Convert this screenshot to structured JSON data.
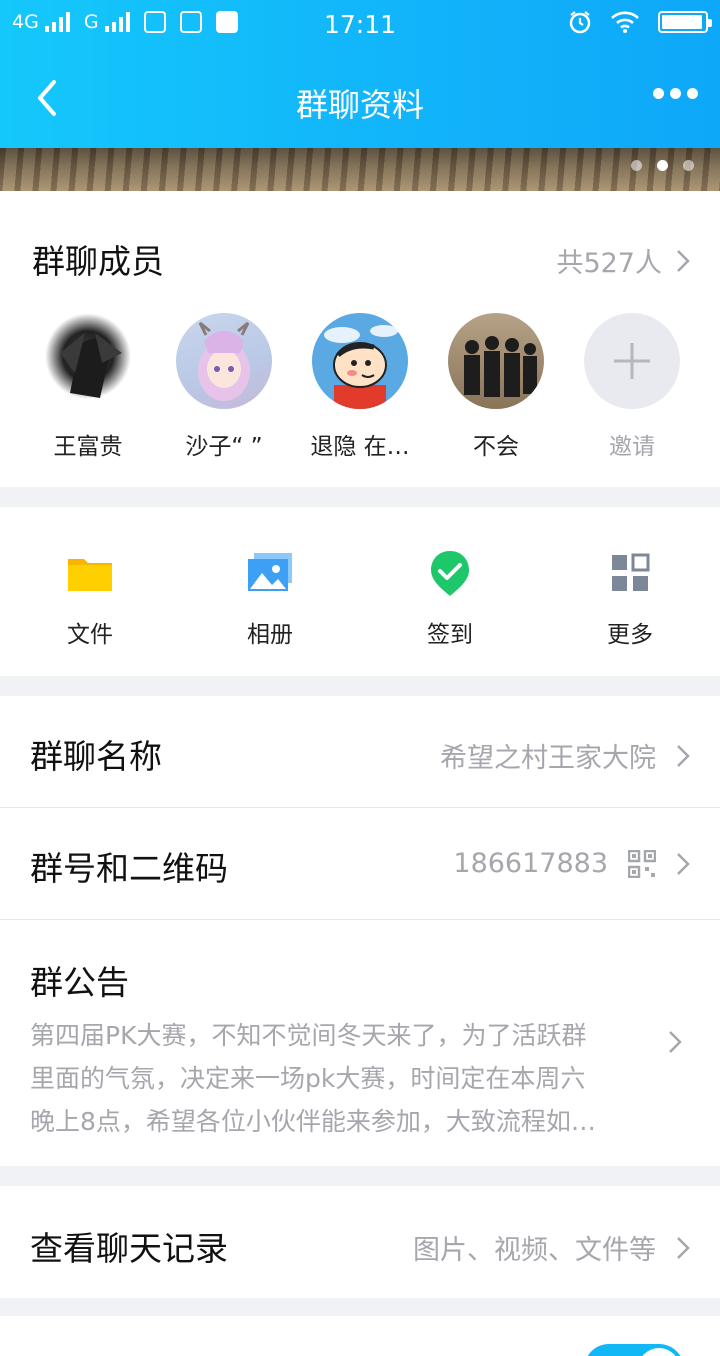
{
  "status_bar": {
    "network1": "4G",
    "network2": "G",
    "time": "17:11"
  },
  "nav": {
    "title": "群聊资料"
  },
  "members": {
    "title": "群聊成员",
    "count": "共527人",
    "list": [
      {
        "name": "王富贵"
      },
      {
        "name": "沙子“ ”"
      },
      {
        "name": "退隐 在…"
      },
      {
        "name": "不会"
      },
      {
        "name": "邀请"
      }
    ]
  },
  "tools": [
    {
      "label": "文件",
      "icon": "folder-icon"
    },
    {
      "label": "相册",
      "icon": "album-icon"
    },
    {
      "label": "签到",
      "icon": "checkin-icon"
    },
    {
      "label": "更多",
      "icon": "grid-icon"
    }
  ],
  "group_name": {
    "title": "群聊名称",
    "value": "希望之村王家大院"
  },
  "group_id": {
    "title": "群号和二维码",
    "value": "186617883"
  },
  "notice": {
    "title": "群公告",
    "lines": [
      "第四届PK大赛，不知不觉间冬天来了，为了活跃群",
      "里面的气氛，决定来一场pk大赛，时间定在本周六",
      "晚上8点，希望各位小伙伴能来参加，大致流程如…"
    ]
  },
  "chat_history": {
    "title": "查看聊天记录",
    "value": "图片、视频、文件等"
  },
  "colors": {
    "accent": "#12b7f5",
    "header_start": "#14c8fb",
    "secondary_text": "#a6a7ad"
  }
}
